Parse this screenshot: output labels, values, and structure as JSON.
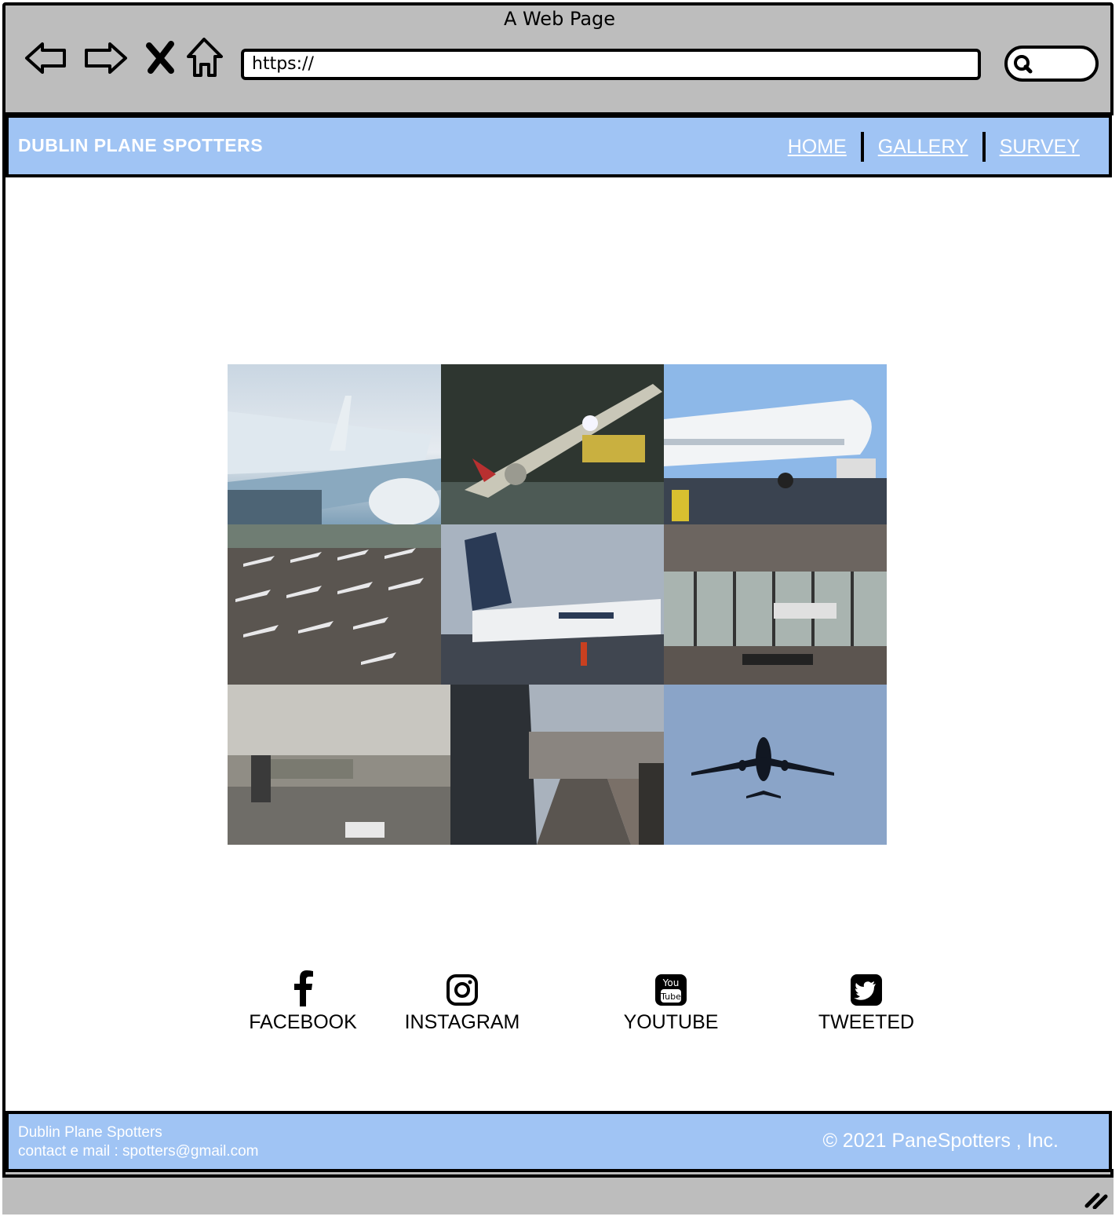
{
  "browser": {
    "title": "A Web Page",
    "url": "https://",
    "buttons": [
      "back-icon",
      "forward-icon",
      "close-icon",
      "home-icon"
    ]
  },
  "site": {
    "brand": "DUBLIN PLANE SPOTTERS",
    "nav": [
      "HOME",
      "GALLERY",
      "SURVEY"
    ],
    "colors": {
      "header_bg": "#a0c4f4",
      "text": "#ffffff"
    }
  },
  "gallery": {
    "images": [
      "wing-view-photo",
      "turkish-airlines-night-photo",
      "turkish-airlines-day-photo",
      "parked-aircraft-aerial-photo",
      "small-plane-tail-photo",
      "terminal-window-photo",
      "airport-apron-hazy-photo",
      "terminal-road-photo",
      "plane-overhead-sky-photo"
    ]
  },
  "social": [
    {
      "label": "FACEBOOK",
      "icon": "facebook-icon"
    },
    {
      "label": "INSTAGRAM",
      "icon": "instagram-icon"
    },
    {
      "label": "YOUTUBE",
      "icon": "youtube-icon"
    },
    {
      "label": "TWEETED",
      "icon": "twitter-icon"
    }
  ],
  "footer": {
    "name": "Dublin Plane Spotters",
    "contact": "contact  e mail : spotters@gmail.com",
    "copyright": "© 2021 PaneSpotters , Inc."
  }
}
